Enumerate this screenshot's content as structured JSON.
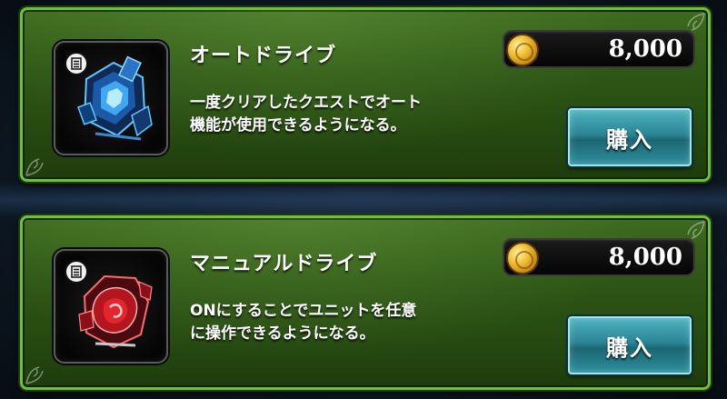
{
  "items": [
    {
      "name": "オートドライブ",
      "price": "8,000",
      "description_line1": "一度クリアしたクエストでオート",
      "description_line2": "機能が使用できるようになる。",
      "buy_label": "購入",
      "icon": "blue-auto-drive-crystal-icon",
      "accent": "#4ad0ff"
    },
    {
      "name": "マニュアルドライブ",
      "price": "8,000",
      "description_line1": "ONにすることでユニットを任意",
      "description_line2": "に操作できるようになる。",
      "buy_label": "購入",
      "icon": "red-manual-drive-crystal-icon",
      "accent": "#e2262e"
    }
  ],
  "colors": {
    "card_border": "#6fbf3a",
    "card_bg": "#2f5716",
    "button": "#2a8594",
    "coin": "#f3c33a"
  }
}
